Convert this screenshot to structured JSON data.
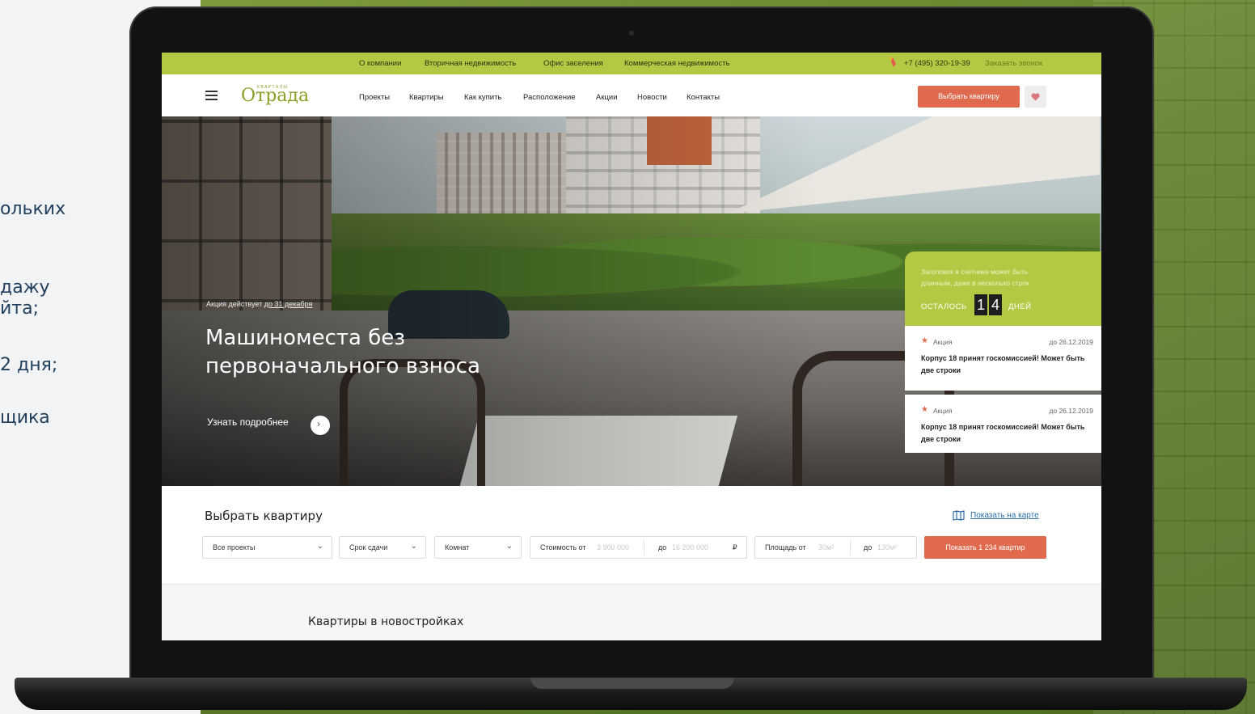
{
  "side_texts": [
    "ольких",
    "дажу",
    "йта;",
    "2 дня;",
    "щика"
  ],
  "topbar": {
    "links": [
      "О компании",
      "Вторичная недвижимость",
      "Офис заселения",
      "Коммерческая недвижимость"
    ],
    "phone": "+7 (495) 320-19-39",
    "callback": "Заказать звонок"
  },
  "header": {
    "logo_sub": "КВАРТАЛЫ",
    "logo": "Отрада",
    "nav": [
      "Проекты",
      "Квартиры",
      "Как купить",
      "Расположение",
      "Акции",
      "Новости",
      "Контакты"
    ],
    "choose_button": "Выбрать квартиру"
  },
  "hero": {
    "promo_note_prefix": "Акция действует ",
    "promo_note_link": "до 31 декабря",
    "title": "Машиноместа без первоначального взноса",
    "more_link": "Узнать подробнее",
    "counter": {
      "heading": "Заголовок в счетчике может быть длинным, даже в несколько строк",
      "left_label": "ОСТАЛОСЬ",
      "digits": [
        "1",
        "4"
      ],
      "days_label": "ДНЕЙ"
    },
    "promos": [
      {
        "tag": "Акция",
        "date": "до 26.12.2019",
        "text": "Корпус 18 принят госкомиссией! Может быть две строки"
      },
      {
        "tag": "Акция",
        "date": "до 26.12.2019",
        "text": "Корпус 18 принят госкомиссией! Может быть две строки"
      }
    ],
    "slides_total": 4,
    "slide_active": 1
  },
  "filter": {
    "title": "Выбрать квартиру",
    "map_link": "Показать на карте",
    "projects": "Все проекты",
    "deadline": "Срок сдачи",
    "rooms": "Комнат",
    "price_from_label": "Стоимость от",
    "price_from_ph": "3 900 000",
    "price_to_label": "до",
    "price_to_ph": "16 200 000",
    "currency": "₽",
    "area_from_label": "Площадь от",
    "area_from_ph": "30м²",
    "area_to_label": "до",
    "area_to_ph": "130м²",
    "show_button": "Показать 1 234 квартир"
  },
  "section": {
    "title": "Квартиры в новостройках"
  },
  "colors": {
    "accent_green": "#b4c843",
    "accent_orange": "#e06a4e",
    "link_blue": "#2b6ea6"
  }
}
